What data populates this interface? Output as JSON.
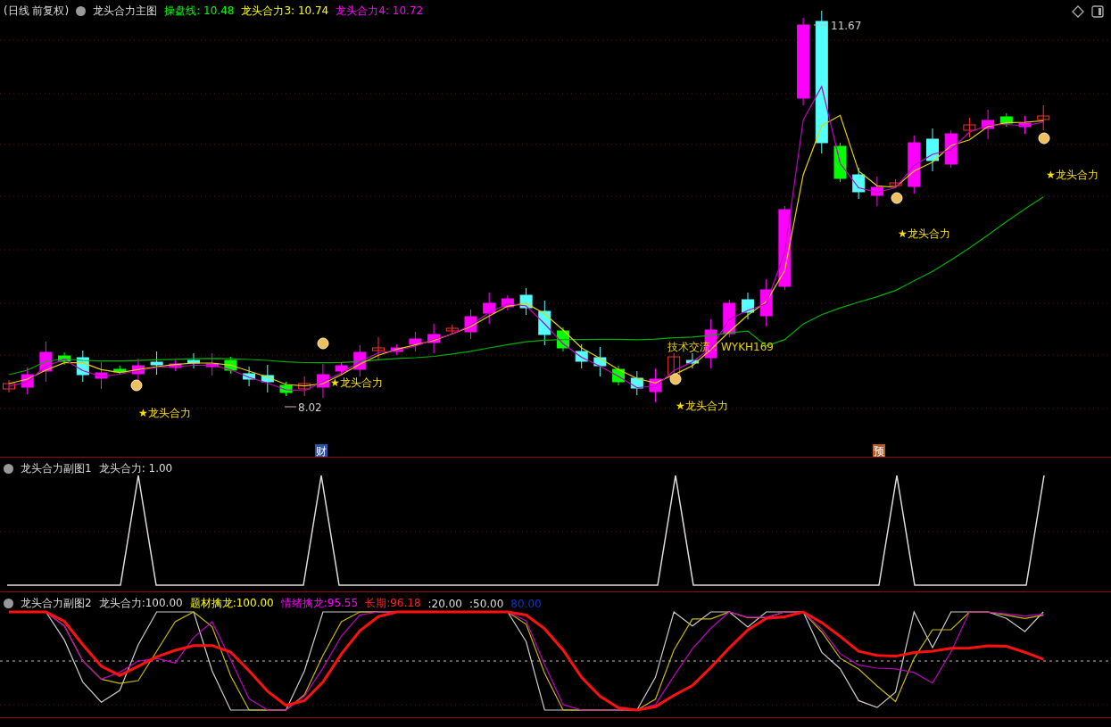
{
  "main_chart": {
    "period": "(日线 前复权)",
    "indicator": "龙头合力主图",
    "legend": [
      {
        "label": "操盘线:",
        "value": "10.48",
        "color": "#00ff00"
      },
      {
        "label": "龙头合力3:",
        "value": "10.74",
        "color": "#ffff00"
      },
      {
        "label": "龙头合力4:",
        "value": "10.72",
        "color": "#ff00ff"
      }
    ],
    "high_label": "11.67",
    "low_label": "8.02",
    "contact": "技术交流：WYKH169",
    "signals": [
      "★龙头合力",
      "★龙头合力",
      "★龙头合力",
      "★龙头合力",
      "★龙头合力"
    ],
    "tags": [
      "财",
      "预"
    ]
  },
  "sub_chart_1": {
    "title": "龙头合力副图1",
    "legend": [
      {
        "label": "龙头合力:",
        "value": "1.00",
        "color": "#dddddd"
      }
    ]
  },
  "sub_chart_2": {
    "title": "龙头合力副图2",
    "legend": [
      {
        "label": "龙头合力:",
        "value": "100.00",
        "color": "#dddddd"
      },
      {
        "label": "题材擒龙:",
        "value": "100.00",
        "color": "#ffff00"
      },
      {
        "label": "情绪擒龙:",
        "value": "95.55",
        "color": "#ff00ff"
      },
      {
        "label": "长期:",
        "value": "96.18",
        "color": "#ff2020"
      },
      {
        "label": ":",
        "value": "20.00",
        "color": "#dddddd"
      },
      {
        "label": ":",
        "value": "50.00",
        "color": "#dddddd"
      },
      {
        "value": "80.00",
        "color": "#1030d0"
      }
    ]
  }
}
